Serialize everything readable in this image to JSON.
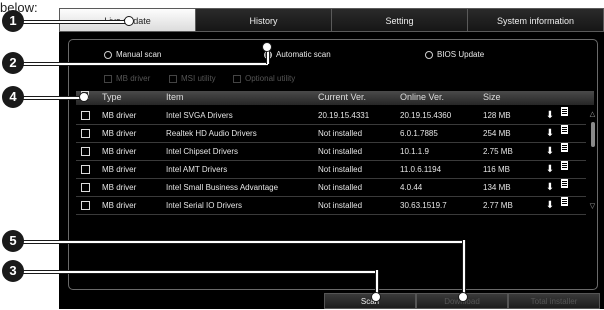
{
  "caption": "below:",
  "tabs": [
    "Live update",
    "History",
    "Setting",
    "System information"
  ],
  "scan_modes": [
    "Manual scan",
    "Automatic scan",
    "BIOS Update"
  ],
  "sub_options": [
    "MB driver",
    "MSI utility",
    "Optional utility"
  ],
  "table": {
    "headers": [
      "Type",
      "Item",
      "Current Ver.",
      "Online Ver.",
      "Size"
    ],
    "rows": [
      {
        "type": "MB driver",
        "item": "Intel SVGA Drivers",
        "current": "20.19.15.4331",
        "online": "20.19.15.4360",
        "size": "128 MB"
      },
      {
        "type": "MB driver",
        "item": "Realtek HD Audio Drivers",
        "current": "Not installed",
        "online": "6.0.1.7885",
        "size": "254 MB"
      },
      {
        "type": "MB driver",
        "item": "Intel Chipset Drivers",
        "current": "Not installed",
        "online": "10.1.1.9",
        "size": "2.75 MB"
      },
      {
        "type": "MB driver",
        "item": "Intel AMT Drivers",
        "current": "Not installed",
        "online": "11.0.6.1194",
        "size": "116 MB"
      },
      {
        "type": "MB driver",
        "item": "Intel Small Business Advantage",
        "current": "Not installed",
        "online": "4.0.44",
        "size": "134 MB"
      },
      {
        "type": "MB driver",
        "item": "Intel Serial IO Drivers",
        "current": "Not installed",
        "online": "30.63.1519.7",
        "size": "2.77 MB"
      }
    ]
  },
  "buttons": {
    "scan": "Scan",
    "download": "Download",
    "total_installer": "Total installer"
  },
  "callouts": [
    "1",
    "2",
    "4",
    "5",
    "3"
  ],
  "icons": {
    "download": "download-arrow-icon",
    "info": "document-icon"
  },
  "colors": {
    "background": "#000000",
    "active_tab": "#f0f0f0",
    "callout": "#1a1a1a"
  }
}
